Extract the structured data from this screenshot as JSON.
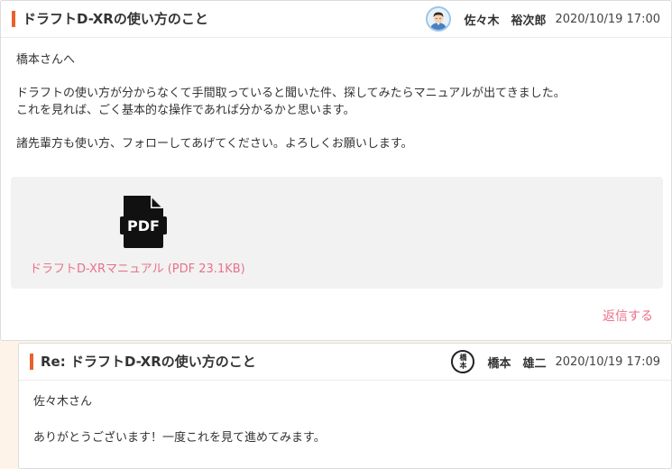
{
  "post": {
    "title": "ドラフトD-XRの使い方のこと",
    "author": "佐々木　裕次郎",
    "date": "2020/10/19 17:00",
    "avatar_icon": "user-avatar-icon",
    "body": {
      "greeting": "橋本さんへ",
      "line1": "ドラフトの使い方が分からなくて手間取っていると聞いた件、探してみたらマニュアルが出てきました。",
      "line2": "これを見れば、ごく基本的な操作であれば分かるかと思います。",
      "line3": "諸先輩方も使い方、フォローしてあげてください。よろしくお願いします。"
    },
    "attachment": {
      "icon": "pdf-file-icon",
      "icon_label": "PDF",
      "link": "ドラフトD-XRマニュアル (PDF 23.1KB)"
    },
    "reply_label": "返信する"
  },
  "reply": {
    "title": "Re: ドラフトD-XRの使い方のこと",
    "author": "橋本　雄二",
    "date": "2020/10/19 17:09",
    "seal": {
      "line1": "橋",
      "line2": "本"
    },
    "body": {
      "greeting": "佐々木さん",
      "line1": "ありがとうございます！一度これを見て進めてみます。"
    }
  },
  "colors": {
    "accent_bar": "#e8622c",
    "link": "#e8728a",
    "background": "#fdf3e8"
  }
}
